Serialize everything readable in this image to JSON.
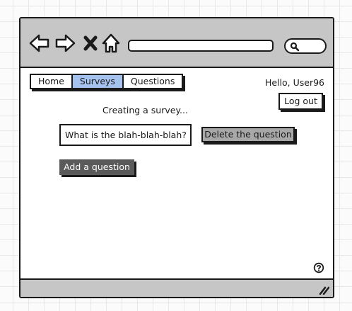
{
  "nav": {
    "tabs": [
      {
        "label": "Home",
        "active": false
      },
      {
        "label": "Surveys",
        "active": true
      },
      {
        "label": "Questions",
        "active": false
      }
    ],
    "active_color": "#a6c2ee"
  },
  "header": {
    "greeting": "Hello, User96",
    "logout_label": "Log out"
  },
  "main": {
    "status": "Creating a survey...",
    "question_value": "What is the blah-blah-blah?",
    "delete_label": "Delete the question",
    "add_label": "Add a question"
  },
  "browser": {
    "icons": [
      "back-arrow-icon",
      "forward-arrow-icon",
      "close-x-icon",
      "home-icon",
      "search-icon",
      "help-icon",
      "resize-handle-icon"
    ]
  }
}
